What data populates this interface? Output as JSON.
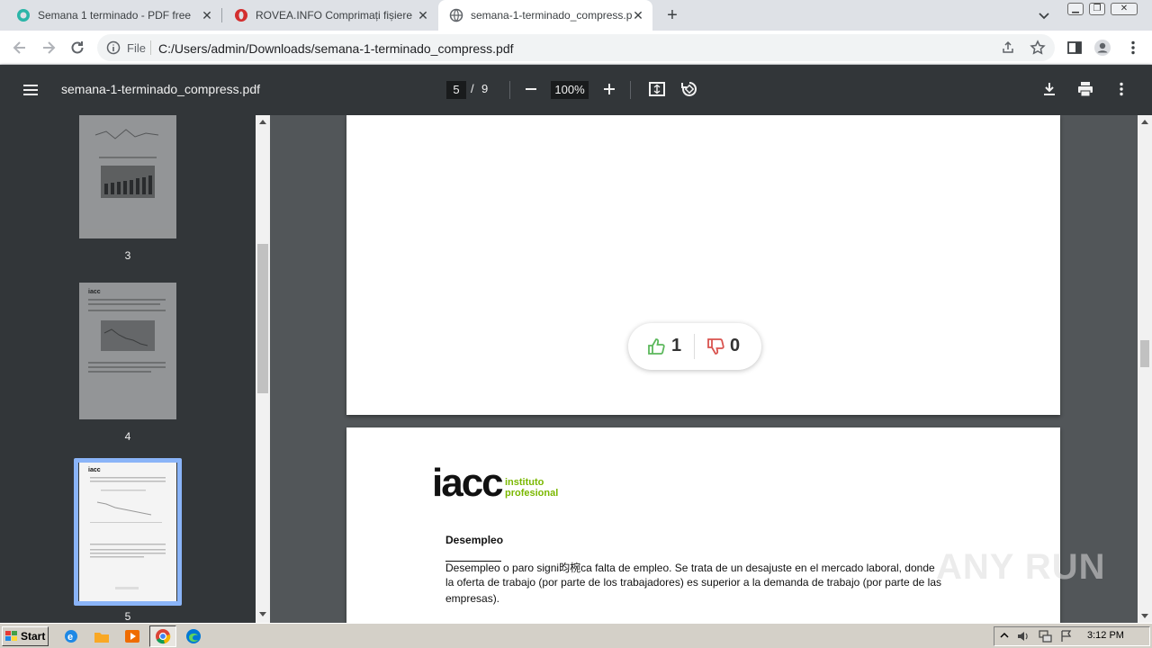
{
  "tabs": [
    {
      "title": "Semana 1 terminado - PDF free",
      "active": false
    },
    {
      "title": "ROVEA.INFO Comprimați fișiere PDF",
      "active": false
    },
    {
      "title": "semana-1-terminado_compress.pdf",
      "active": true
    }
  ],
  "address": {
    "scheme_label": "File",
    "url": "C:/Users/admin/Downloads/semana-1-terminado_compress.pdf"
  },
  "pdf": {
    "title": "semana-1-terminado_compress.pdf",
    "current_page": "5",
    "separator": "/",
    "total_pages": "9",
    "zoom": "100%"
  },
  "thumbnails": [
    {
      "label": "3"
    },
    {
      "label": "4"
    },
    {
      "label": "5",
      "selected": true
    }
  ],
  "votes": {
    "up": "1",
    "down": "0"
  },
  "document": {
    "logo_main": "iacc",
    "logo_sub_1": "instituto",
    "logo_sub_2": "profesional",
    "heading": "Desempleo",
    "lines": [
      "Desempleo o paro signi昀椀ca falta de empleo. Se trata de un desajuste en el mercado laboral, donde",
      "la oferta de trabajo (por parte de los trabajadores) es superior a la demanda de trabajo (por parte de las",
      "empresas)."
    ]
  },
  "watermark": "ANY RUN",
  "taskbar": {
    "start_label": "Start",
    "clock": "3:12 PM"
  },
  "colors": {
    "pdf_toolbar": "#323639",
    "doc_background": "#525659",
    "logo_green": "#7ab800",
    "thumb_selected": "#8ab4f8",
    "vote_up": "#5cb85c",
    "vote_down": "#d9534f"
  }
}
